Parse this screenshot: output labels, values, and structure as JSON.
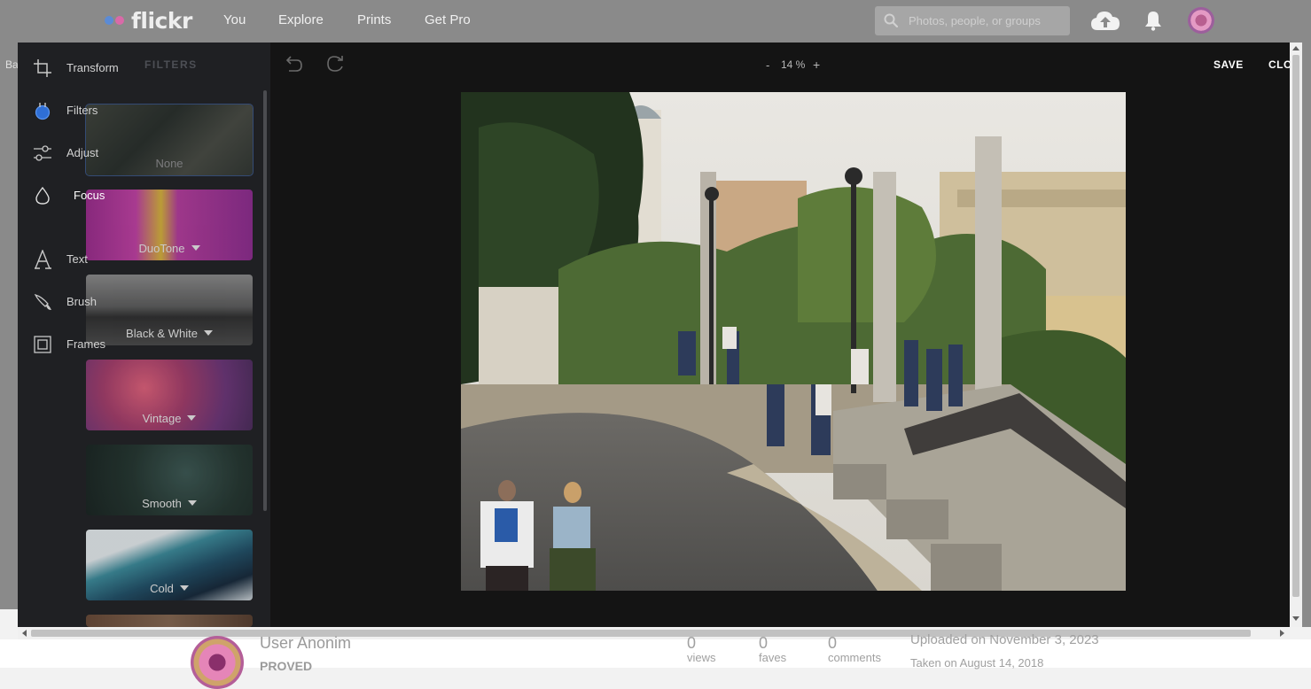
{
  "topnav": {
    "logo": "flickr",
    "links": [
      "You",
      "Explore",
      "Prints",
      "Get Pro"
    ],
    "search_placeholder": "Photos, people, or groups"
  },
  "background": {
    "left_partial": "Ba"
  },
  "editor": {
    "tools": [
      {
        "label": "Transform",
        "icon": "transform-icon"
      },
      {
        "label": "Filters",
        "icon": "filters-icon"
      },
      {
        "label": "Adjust",
        "icon": "adjust-icon"
      },
      {
        "label": "Focus",
        "icon": "focus-icon"
      },
      {
        "label": "Text",
        "icon": "text-icon"
      },
      {
        "label": "Brush",
        "icon": "brush-icon"
      },
      {
        "label": "Frames",
        "icon": "frames-icon"
      }
    ],
    "active_tool": "Focus",
    "panel_title": "FILTERS",
    "filters": [
      {
        "label": "None",
        "dropdown": false
      },
      {
        "label": "DuoTone",
        "dropdown": true
      },
      {
        "label": "Black & White",
        "dropdown": true
      },
      {
        "label": "Vintage",
        "dropdown": true
      },
      {
        "label": "Smooth",
        "dropdown": true
      },
      {
        "label": "Cold",
        "dropdown": true
      }
    ],
    "selected_filter": "None",
    "zoom": {
      "minus": "-",
      "value": "14 %",
      "plus": "+"
    },
    "save_label": "SAVE",
    "close_label": "CLO",
    "accent_color": "#4e7fd9"
  },
  "photo_info": {
    "user_name": "User Anonim",
    "user_sub": "PROVED",
    "stats": [
      {
        "num": "0",
        "label": "views"
      },
      {
        "num": "0",
        "label": "faves"
      },
      {
        "num": "0",
        "label": "comments"
      }
    ],
    "uploaded": "Uploaded on November 3, 2023",
    "taken": "Taken on August 14, 2018"
  }
}
